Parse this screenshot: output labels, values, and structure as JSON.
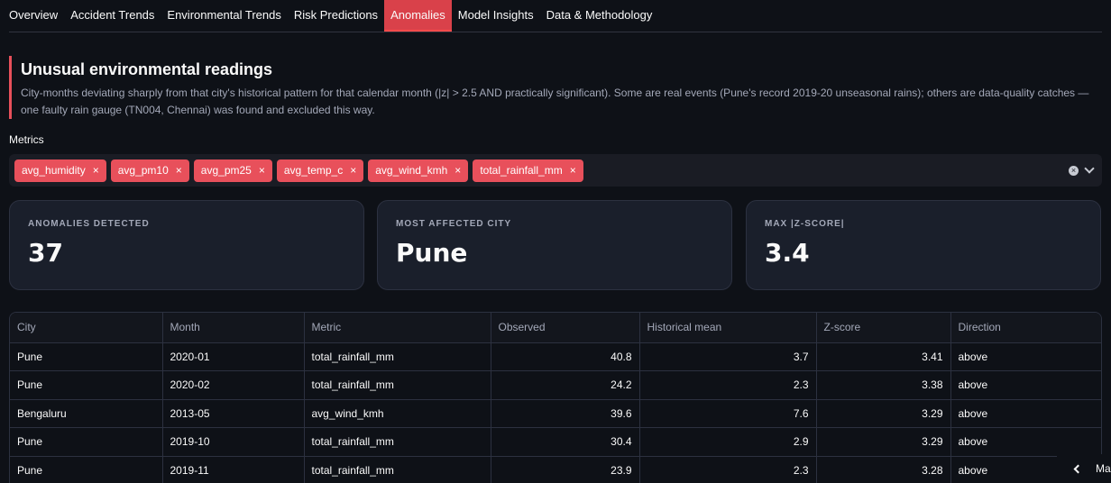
{
  "tabs": [
    {
      "label": "Overview",
      "active": false
    },
    {
      "label": "Accident Trends",
      "active": false
    },
    {
      "label": "Environmental Trends",
      "active": false
    },
    {
      "label": "Risk Predictions",
      "active": false
    },
    {
      "label": "Anomalies",
      "active": true
    },
    {
      "label": "Model Insights",
      "active": false
    },
    {
      "label": "Data & Methodology",
      "active": false
    }
  ],
  "section": {
    "title": "Unusual environmental readings",
    "description": "City-months deviating sharply from that city's historical pattern for that calendar month (|z| > 2.5 AND practically significant). Some are real events (Pune's record 2019-20 unseasonal rains); others are data-quality catches — one faulty rain gauge (TN004, Chennai) was found and excluded this way."
  },
  "metrics": {
    "label": "Metrics",
    "selected": [
      "avg_humidity",
      "avg_pm10",
      "avg_pm25",
      "avg_temp_c",
      "avg_wind_kmh",
      "total_rainfall_mm"
    ],
    "remove_glyph": "×",
    "clear_glyph": "×",
    "chevron_glyph": "⌄"
  },
  "kpis": [
    {
      "label": "ANOMALIES DETECTED",
      "value": "37"
    },
    {
      "label": "MOST AFFECTED CITY",
      "value": "Pune"
    },
    {
      "label": "MAX |Z-SCORE|",
      "value": "3.4"
    }
  ],
  "table": {
    "columns": [
      "City",
      "Month",
      "Metric",
      "Observed",
      "Historical mean",
      "Z-score",
      "Direction"
    ],
    "rows": [
      [
        "Pune",
        "2020-01",
        "total_rainfall_mm",
        "40.8",
        "3.7",
        "3.41",
        "above"
      ],
      [
        "Pune",
        "2020-02",
        "total_rainfall_mm",
        "24.2",
        "2.3",
        "3.38",
        "above"
      ],
      [
        "Bengaluru",
        "2013-05",
        "avg_wind_kmh",
        "39.6",
        "7.6",
        "3.29",
        "above"
      ],
      [
        "Pune",
        "2019-10",
        "total_rainfall_mm",
        "30.4",
        "2.9",
        "3.29",
        "above"
      ],
      [
        "Pune",
        "2019-11",
        "total_rainfall_mm",
        "23.9",
        "2.3",
        "3.28",
        "above"
      ]
    ]
  },
  "sidebar_toggle": {
    "label": "Ma",
    "glyph": "‹"
  },
  "colors": {
    "accent": "#e8505b",
    "background": "#0e1117",
    "card": "#1a1f2b"
  }
}
